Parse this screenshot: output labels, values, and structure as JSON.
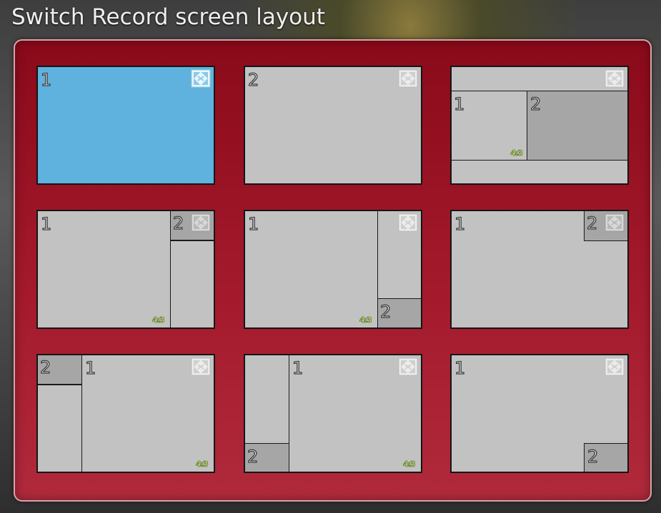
{
  "title": "Switch Record screen layout",
  "layouts": [
    {
      "main_label": "1",
      "sub_label": "",
      "ratio": "",
      "icon": "fullscreen-icon",
      "selected": true
    },
    {
      "main_label": "2",
      "sub_label": "",
      "ratio": "",
      "icon": "fullscreen-icon",
      "selected": false
    },
    {
      "main_label": "1",
      "sub_label": "2",
      "ratio": "4:3",
      "icon": "fullscreen-icon",
      "selected": false
    },
    {
      "main_label": "1",
      "sub_label": "2",
      "ratio": "4:3",
      "icon": "fullscreen-icon",
      "selected": false
    },
    {
      "main_label": "1",
      "sub_label": "2",
      "ratio": "4:3",
      "icon": "fullscreen-icon",
      "selected": false
    },
    {
      "main_label": "1",
      "sub_label": "2",
      "ratio": "",
      "icon": "fullscreen-icon",
      "selected": false
    },
    {
      "main_label": "1",
      "sub_label": "2",
      "ratio": "4:3",
      "icon": "fullscreen-icon",
      "selected": false
    },
    {
      "main_label": "1",
      "sub_label": "2",
      "ratio": "4:3",
      "icon": "fullscreen-icon",
      "selected": false
    },
    {
      "main_label": "1",
      "sub_label": "2",
      "ratio": "",
      "icon": "fullscreen-icon",
      "selected": false
    }
  ],
  "colors": {
    "panel": "#a41a2c",
    "selected": "#5fb2dd",
    "tile": "#c2c2c2",
    "inset": "#a6a6a6"
  }
}
